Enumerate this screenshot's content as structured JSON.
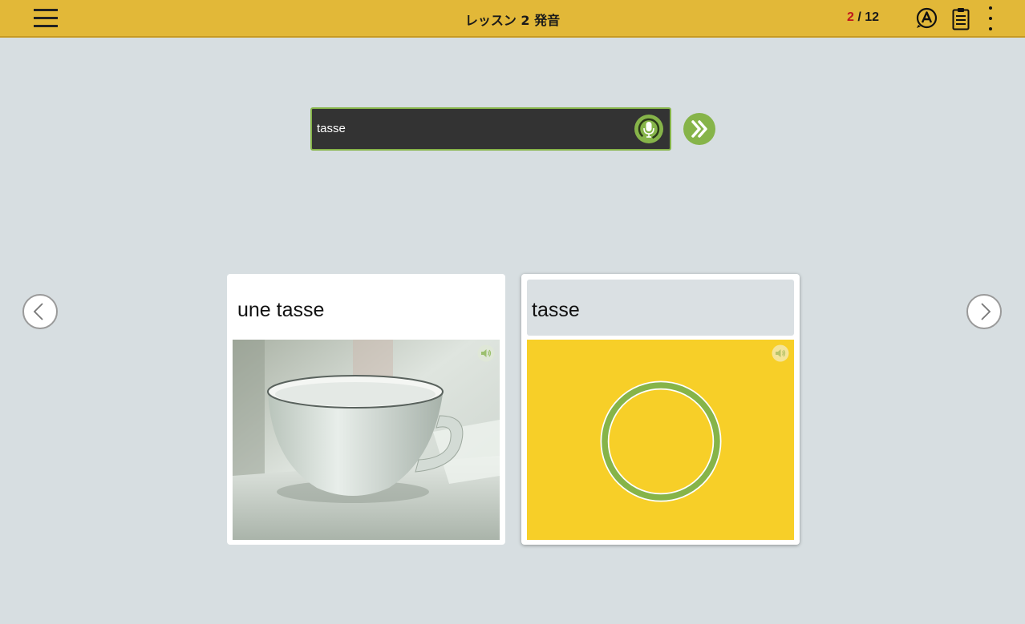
{
  "header": {
    "title": "レッスン 2 発音",
    "progress": {
      "current": "2",
      "separator": " / ",
      "total": "12"
    },
    "icons": [
      "menu-icon",
      "answer-icon",
      "notes-icon",
      "more-icon"
    ]
  },
  "pronunciation": {
    "input_value": "tasse",
    "mic_icon": "microphone-icon",
    "next_icon": "double-chevron-right-icon"
  },
  "cards": [
    {
      "label": "une tasse",
      "image": "teacup-photo",
      "audio_icon": "speaker-icon"
    },
    {
      "label": "tasse",
      "image": "recording-ring",
      "audio_icon": "speaker-icon"
    }
  ],
  "navigation": {
    "prev_icon": "chevron-left-icon",
    "next_icon": "chevron-right-icon"
  },
  "colors": {
    "header_bg": "#e2b838",
    "accent_green": "#86b449",
    "counter_current": "#c0161d",
    "background": "#d7dee1",
    "input_bg": "#333333",
    "card2_image_bg": "#f7cf28"
  }
}
